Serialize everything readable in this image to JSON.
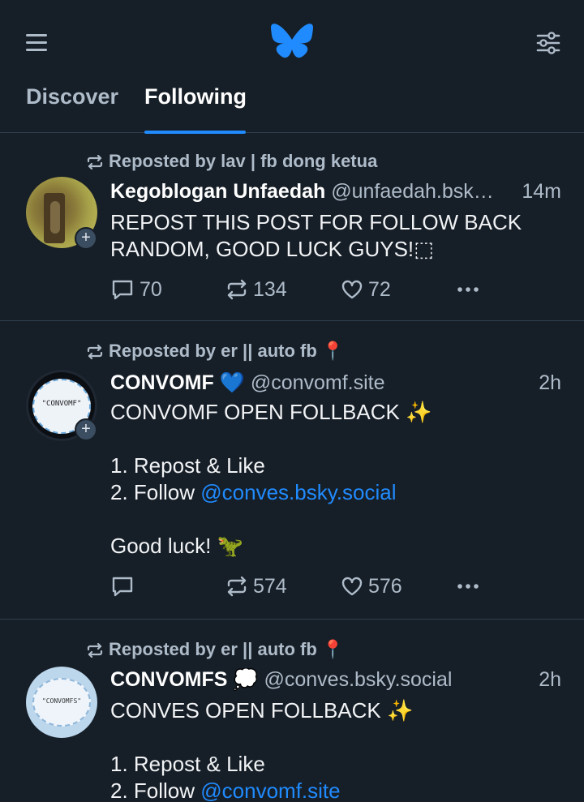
{
  "header": {
    "menu_icon": "menu-icon",
    "logo_icon": "butterfly-logo-icon",
    "feeds_icon": "sliders-icon",
    "accent": "#208bfe"
  },
  "tabs": [
    {
      "label": "Discover"
    },
    {
      "label": "Following"
    }
  ],
  "posts": [
    {
      "repost_text": "Reposted by lav | fb dong ketua",
      "author_name": "Kegoblogan Unfaedah",
      "author_handle": "@unfaedah.bsk…",
      "time": "14m",
      "text_lines": [
        "REPOST THIS POST FOR FOLLOW BACK",
        "RANDOM, GOOD LUCK GUYS!⬚"
      ],
      "reply_count": "70",
      "repost_count": "134",
      "like_count": "72"
    },
    {
      "repost_text": "Reposted by er || auto fb 📍",
      "author_name": "CONVOMF 💙",
      "author_handle": "@convomf.site",
      "time": "2h",
      "text_line1": "CONVOMF OPEN FOLLBACK ✨",
      "text_line2": "1. Repost & Like",
      "text_line3_prefix": "2. Follow ",
      "mention": "@conves.bsky.social",
      "text_line4": "Good luck! 🦖",
      "avatar_text": "\"CONVOMF\"",
      "reply_count": "",
      "repost_count": "574",
      "like_count": "576"
    },
    {
      "repost_text": "Reposted by er || auto fb 📍",
      "author_name": "CONVOMFS 💭",
      "author_handle": "@conves.bsky.social",
      "time": "2h",
      "text_line1": "CONVES OPEN FOLLBACK ✨",
      "text_line2": "1. Repost & Like",
      "text_line3_prefix": "2. Follow ",
      "mention": "@convomf.site",
      "avatar_text": "\"CONVOMFS\""
    }
  ]
}
